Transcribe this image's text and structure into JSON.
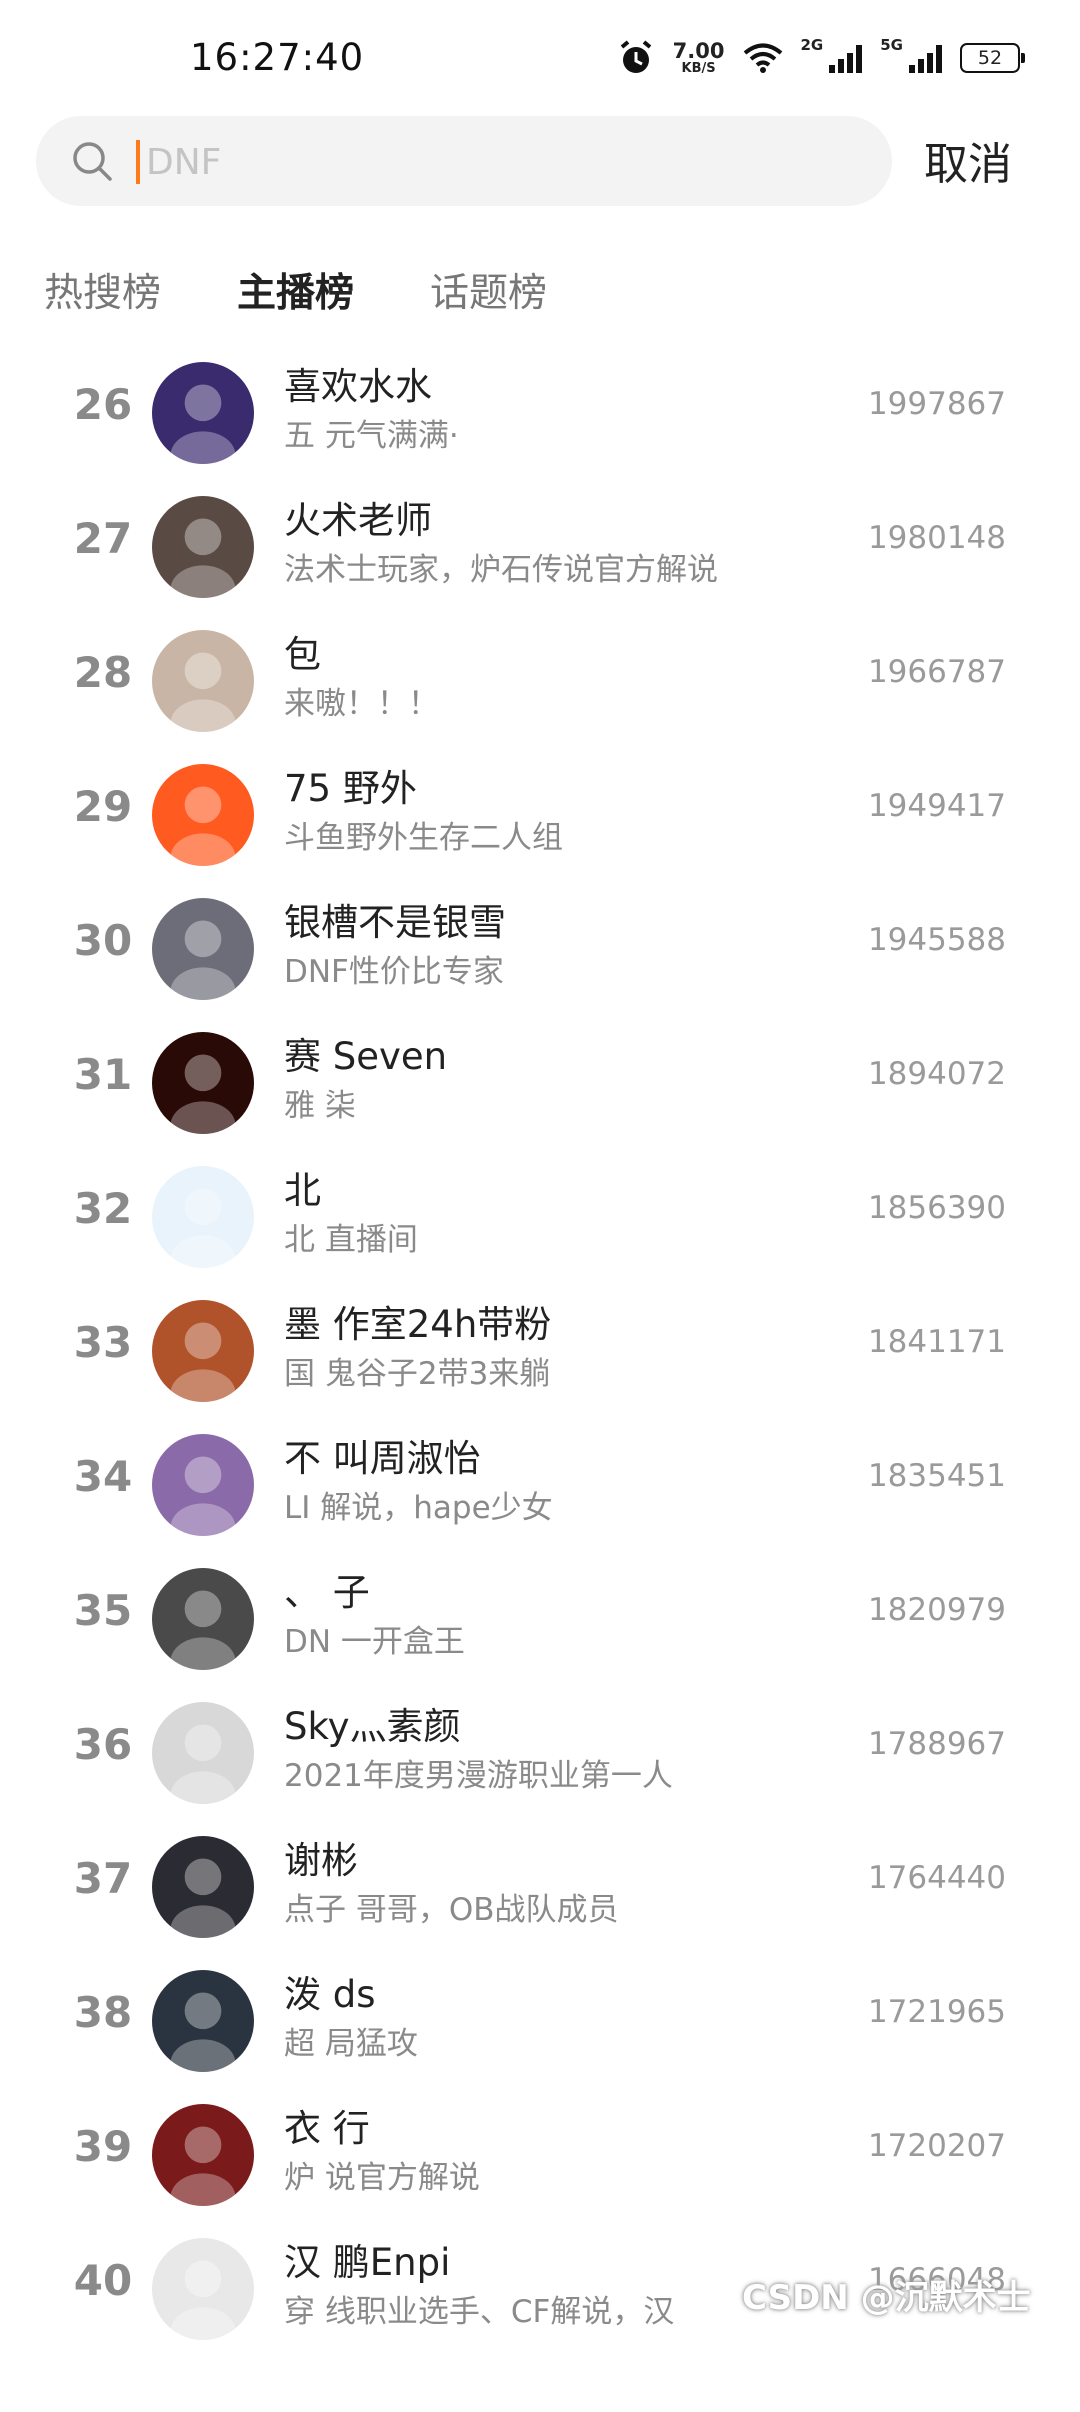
{
  "status_bar": {
    "time": "16:27:40",
    "speed_value": "7.00",
    "speed_unit": "KB/S",
    "signal_1": "2G",
    "signal_2": "5G",
    "battery": "52",
    "icons": [
      "alarm-icon",
      "wifi-icon",
      "signal-icon",
      "signal-icon",
      "battery-icon"
    ]
  },
  "search": {
    "placeholder": "DNF",
    "icon": "search-icon",
    "cancel_label": "取消"
  },
  "tabs": [
    {
      "label": "热搜榜",
      "active": false
    },
    {
      "label": "主播榜",
      "active": true
    },
    {
      "label": "话题榜",
      "active": false
    }
  ],
  "list": [
    {
      "rank": "26",
      "name": "喜欢水水",
      "desc": "五  元气满满·",
      "score": "1997867",
      "avatar_color": "#3a2a6e"
    },
    {
      "rank": "27",
      "name": "  火术老师",
      "desc": "  法术士玩家，炉石传说官方解说",
      "score": "1980148",
      "avatar_color": "#5a4a44"
    },
    {
      "rank": "28",
      "name": "  包",
      "desc": "  来嗷！！！",
      "score": "1966787",
      "avatar_color": "#c9b5a5"
    },
    {
      "rank": "29",
      "name": "75  野外",
      "desc": "斗鱼野外生存二人组",
      "score": "1949417",
      "avatar_color": "#ff5a1f"
    },
    {
      "rank": "30",
      "name": "银槽不是银雪",
      "desc": "DNF性价比专家",
      "score": "1945588",
      "avatar_color": "#6d6d7a"
    },
    {
      "rank": "31",
      "name": "赛  Seven",
      "desc": "雅  柒",
      "score": "1894072",
      "avatar_color": "#2a0a06"
    },
    {
      "rank": "32",
      "name": "北",
      "desc": "北  直播间",
      "score": "1856390",
      "avatar_color": "#e9f3fb"
    },
    {
      "rank": "33",
      "name": "墨  作室24h带粉",
      "desc": "国  鬼谷子2带3来躺",
      "score": "1841171",
      "avatar_color": "#b0522a"
    },
    {
      "rank": "34",
      "name": "不  叫周淑怡",
      "desc": "LI  解说，hape少女",
      "score": "1835451",
      "avatar_color": "#8a6aa8"
    },
    {
      "rank": "35",
      "name": "、  子",
      "desc": "DN  一开盒王",
      "score": "1820979",
      "avatar_color": "#4a4a4a"
    },
    {
      "rank": "36",
      "name": "Sky灬素颜",
      "desc": "2021年度男漫游职业第一人",
      "score": "1788967",
      "avatar_color": "#d8d8d8"
    },
    {
      "rank": "37",
      "name": "谢彬",
      "desc": "点子  哥哥，OB战队成员",
      "score": "1764440",
      "avatar_color": "#2b2b33"
    },
    {
      "rank": "38",
      "name": "泼  ds",
      "desc": "超  局猛攻",
      "score": "1721965",
      "avatar_color": "#2a3440"
    },
    {
      "rank": "39",
      "name": "衣  行",
      "desc": "炉  说官方解说",
      "score": "1720207",
      "avatar_color": "#7a1a1a"
    },
    {
      "rank": "40",
      "name": "汉  鹏Enpi",
      "desc": "穿  线职业选手、CF解说，汉",
      "score": "1666048",
      "avatar_color": "#e8e8e8"
    }
  ],
  "watermark": "CSDN @沉默术士"
}
